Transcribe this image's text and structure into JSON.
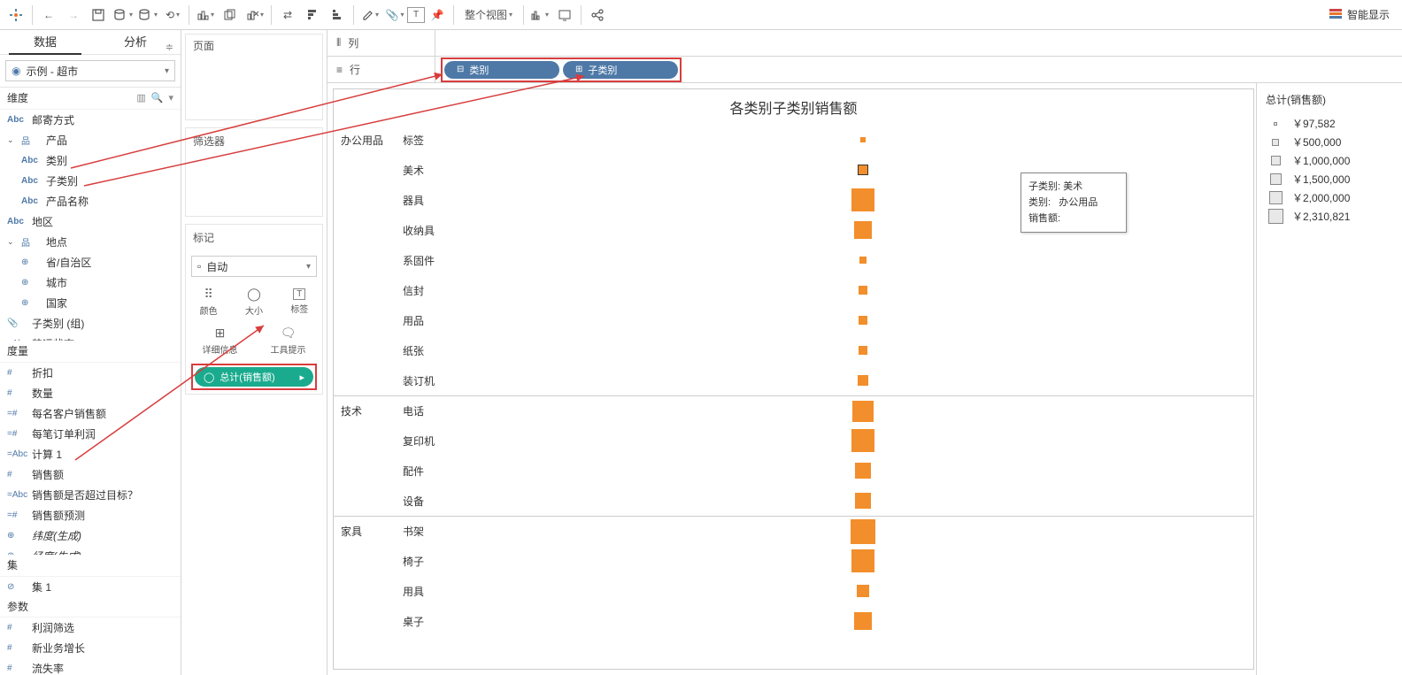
{
  "toolbar": {
    "view_fit_label": "整个视图",
    "smart_show_label": "智能显示"
  },
  "left": {
    "tab_data": "数据",
    "tab_analysis": "分析",
    "datasource": "示例 - 超市",
    "dimensions_header": "维度",
    "measures_header": "度量",
    "sets_header": "集",
    "params_header": "参数",
    "dimensions": {
      "ship_mode": "邮寄方式",
      "product": "产品",
      "category": "类别",
      "subcategory": "子类别",
      "product_name": "产品名称",
      "region": "地区",
      "location": "地点",
      "province": "省/自治区",
      "city": "城市",
      "country": "国家",
      "subcat_group": "子类别 (组)",
      "ship_status": "装运状态"
    },
    "measures": {
      "discount": "折扣",
      "quantity": "数量",
      "sales_per_customer": "每名客户销售额",
      "profit_per_order": "每笔订单利润",
      "calc1": "计算 1",
      "sales": "销售额",
      "sales_over_target": "销售额是否超过目标？",
      "sales_forecast": "销售额预测",
      "latitude": "纬度(生成)",
      "longitude": "经度(生成)"
    },
    "sets": {
      "set1": "集 1"
    },
    "params": {
      "profit_filter": "利润筛选",
      "biz_growth": "新业务增长",
      "churn": "流失率"
    }
  },
  "mid": {
    "pages_label": "页面",
    "filters_label": "筛选器",
    "marks_label": "标记",
    "mark_type": "自动",
    "color": "颜色",
    "size": "大小",
    "label": "标签",
    "detail": "详细信息",
    "tooltip": "工具提示",
    "pill_label": "总计(销售额)"
  },
  "shelves": {
    "columns_icon": "列",
    "rows_icon": "行",
    "pill_category": "类别",
    "pill_subcategory": "子类别"
  },
  "viz": {
    "title": "各类别子类别销售额",
    "tooltip": {
      "l1_k": "子类别:",
      "l1_v": "美术",
      "l2_k": "类别:",
      "l2_v": "办公用品",
      "l3_k": "销售额:"
    }
  },
  "legend": {
    "title": "总计(销售额)",
    "items": [
      {
        "label": "￥97,582",
        "size": 4
      },
      {
        "label": "￥500,000",
        "size": 8
      },
      {
        "label": "￥1,000,000",
        "size": 11
      },
      {
        "label": "￥1,500,000",
        "size": 13
      },
      {
        "label": "￥2,000,000",
        "size": 15
      },
      {
        "label": "￥2,310,821",
        "size": 17
      }
    ]
  },
  "chart_data": {
    "type": "table",
    "title": "各类别子类别销售额",
    "size_encoding_field": "总计(销售额)",
    "categories": [
      {
        "name": "办公用品",
        "sub": [
          {
            "name": "标签",
            "size": 6
          },
          {
            "name": "美术",
            "size": 10,
            "highlighted": true
          },
          {
            "name": "器具",
            "size": 26
          },
          {
            "name": "收纳具",
            "size": 20
          },
          {
            "name": "系固件",
            "size": 8
          },
          {
            "name": "信封",
            "size": 10
          },
          {
            "name": "用品",
            "size": 10
          },
          {
            "name": "纸张",
            "size": 10
          },
          {
            "name": "装订机",
            "size": 12
          }
        ]
      },
      {
        "name": "技术",
        "sub": [
          {
            "name": "电话",
            "size": 24
          },
          {
            "name": "复印机",
            "size": 26
          },
          {
            "name": "配件",
            "size": 18
          },
          {
            "name": "设备",
            "size": 18
          }
        ]
      },
      {
        "name": "家具",
        "sub": [
          {
            "name": "书架",
            "size": 28
          },
          {
            "name": "椅子",
            "size": 26
          },
          {
            "name": "用具",
            "size": 14
          },
          {
            "name": "桌子",
            "size": 20
          }
        ]
      }
    ]
  }
}
